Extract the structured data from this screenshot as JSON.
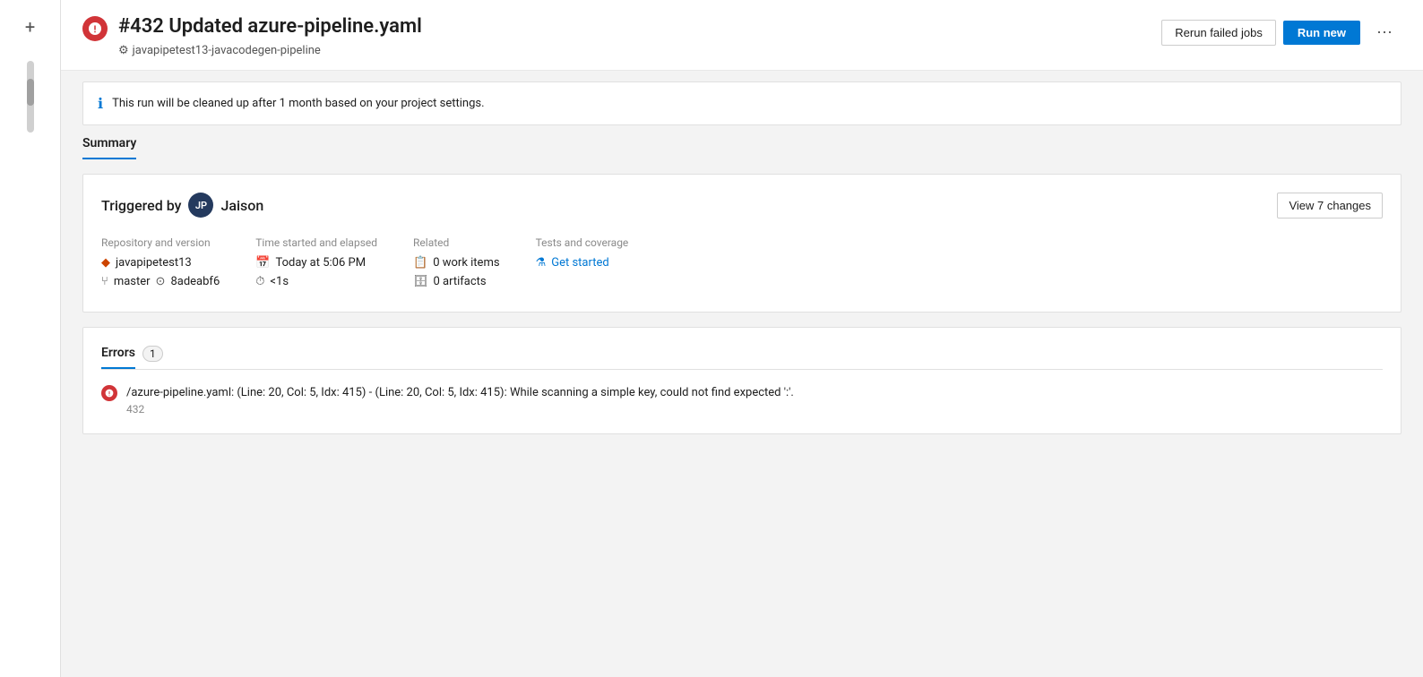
{
  "sidebar": {
    "add_label": "+"
  },
  "header": {
    "title": "#432 Updated azure-pipeline.yaml",
    "subtitle": "javapipetest13-javacodegen-pipeline",
    "rerun_button": "Rerun failed jobs",
    "run_new_button": "Run new"
  },
  "banner": {
    "text": "This run will be cleaned up after 1 month based on your project settings."
  },
  "summary": {
    "tab_label": "Summary",
    "triggered_label": "Triggered by",
    "triggered_by": "Jaison",
    "avatar_initials": "JP",
    "view_changes_button": "View 7 changes",
    "repo_version_label": "Repository and version",
    "repo_name": "javapipetest13",
    "branch": "master",
    "commit": "8adeabf6",
    "time_label": "Time started and elapsed",
    "time_started": "Today at 5:06 PM",
    "time_elapsed": "<1s",
    "related_label": "Related",
    "work_items": "0 work items",
    "artifacts": "0 artifacts",
    "tests_label": "Tests and coverage",
    "get_started": "Get started"
  },
  "errors": {
    "tab_label": "Errors",
    "count": "1",
    "error_message": "/azure-pipeline.yaml: (Line: 20, Col: 5, Idx: 415) - (Line: 20, Col: 5, Idx: 415): While scanning a simple key, could not find expected ':'.",
    "error_id": "432"
  }
}
